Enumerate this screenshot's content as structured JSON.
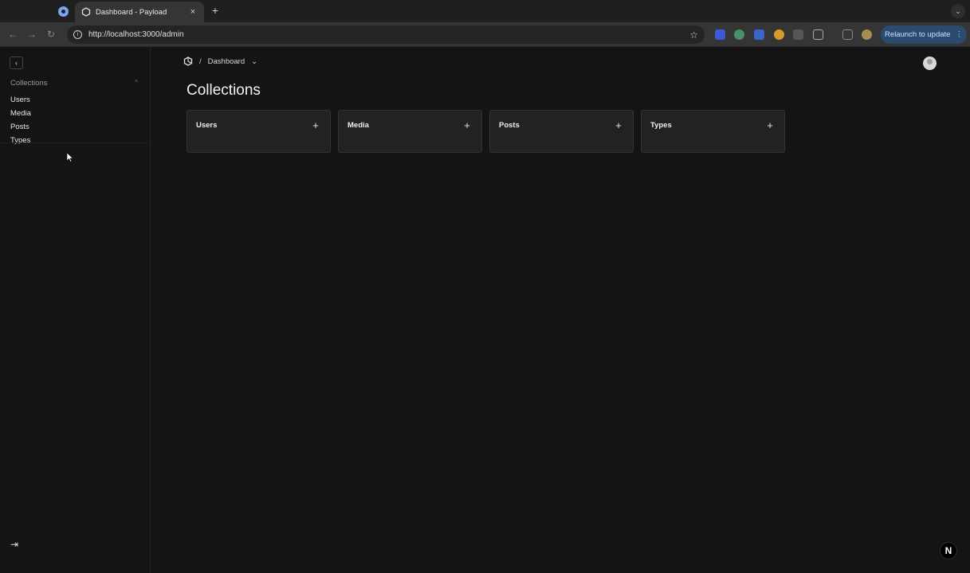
{
  "browser": {
    "tab_title": "Dashboard - Payload",
    "tab_close": "×",
    "new_tab": "+",
    "tab_menu": "⌄",
    "back": "←",
    "forward": "→",
    "reload": "↻",
    "info": "i",
    "url": "http://localhost:3000/admin",
    "star": "☆",
    "relaunch_label": "Relaunch to update",
    "relaunch_menu": "⋮"
  },
  "sidebar": {
    "collapse_icon": "‹",
    "group_label": "Collections",
    "group_chevron": "^",
    "items": [
      {
        "label": "Users"
      },
      {
        "label": "Media"
      },
      {
        "label": "Posts"
      },
      {
        "label": "Types"
      }
    ],
    "logout_icon": "⇥"
  },
  "header": {
    "breadcrumb_sep": "/",
    "breadcrumb_current": "Dashboard",
    "breadcrumb_chevron": "⌄"
  },
  "main": {
    "title": "Collections",
    "cards": [
      {
        "label": "Users",
        "add": "+"
      },
      {
        "label": "Media",
        "add": "+"
      },
      {
        "label": "Posts",
        "add": "+"
      },
      {
        "label": "Types",
        "add": "+"
      }
    ]
  },
  "next_badge": "N",
  "colors": {
    "background": "#141414",
    "card": "#222222",
    "relaunch": "#2a4a6f"
  }
}
